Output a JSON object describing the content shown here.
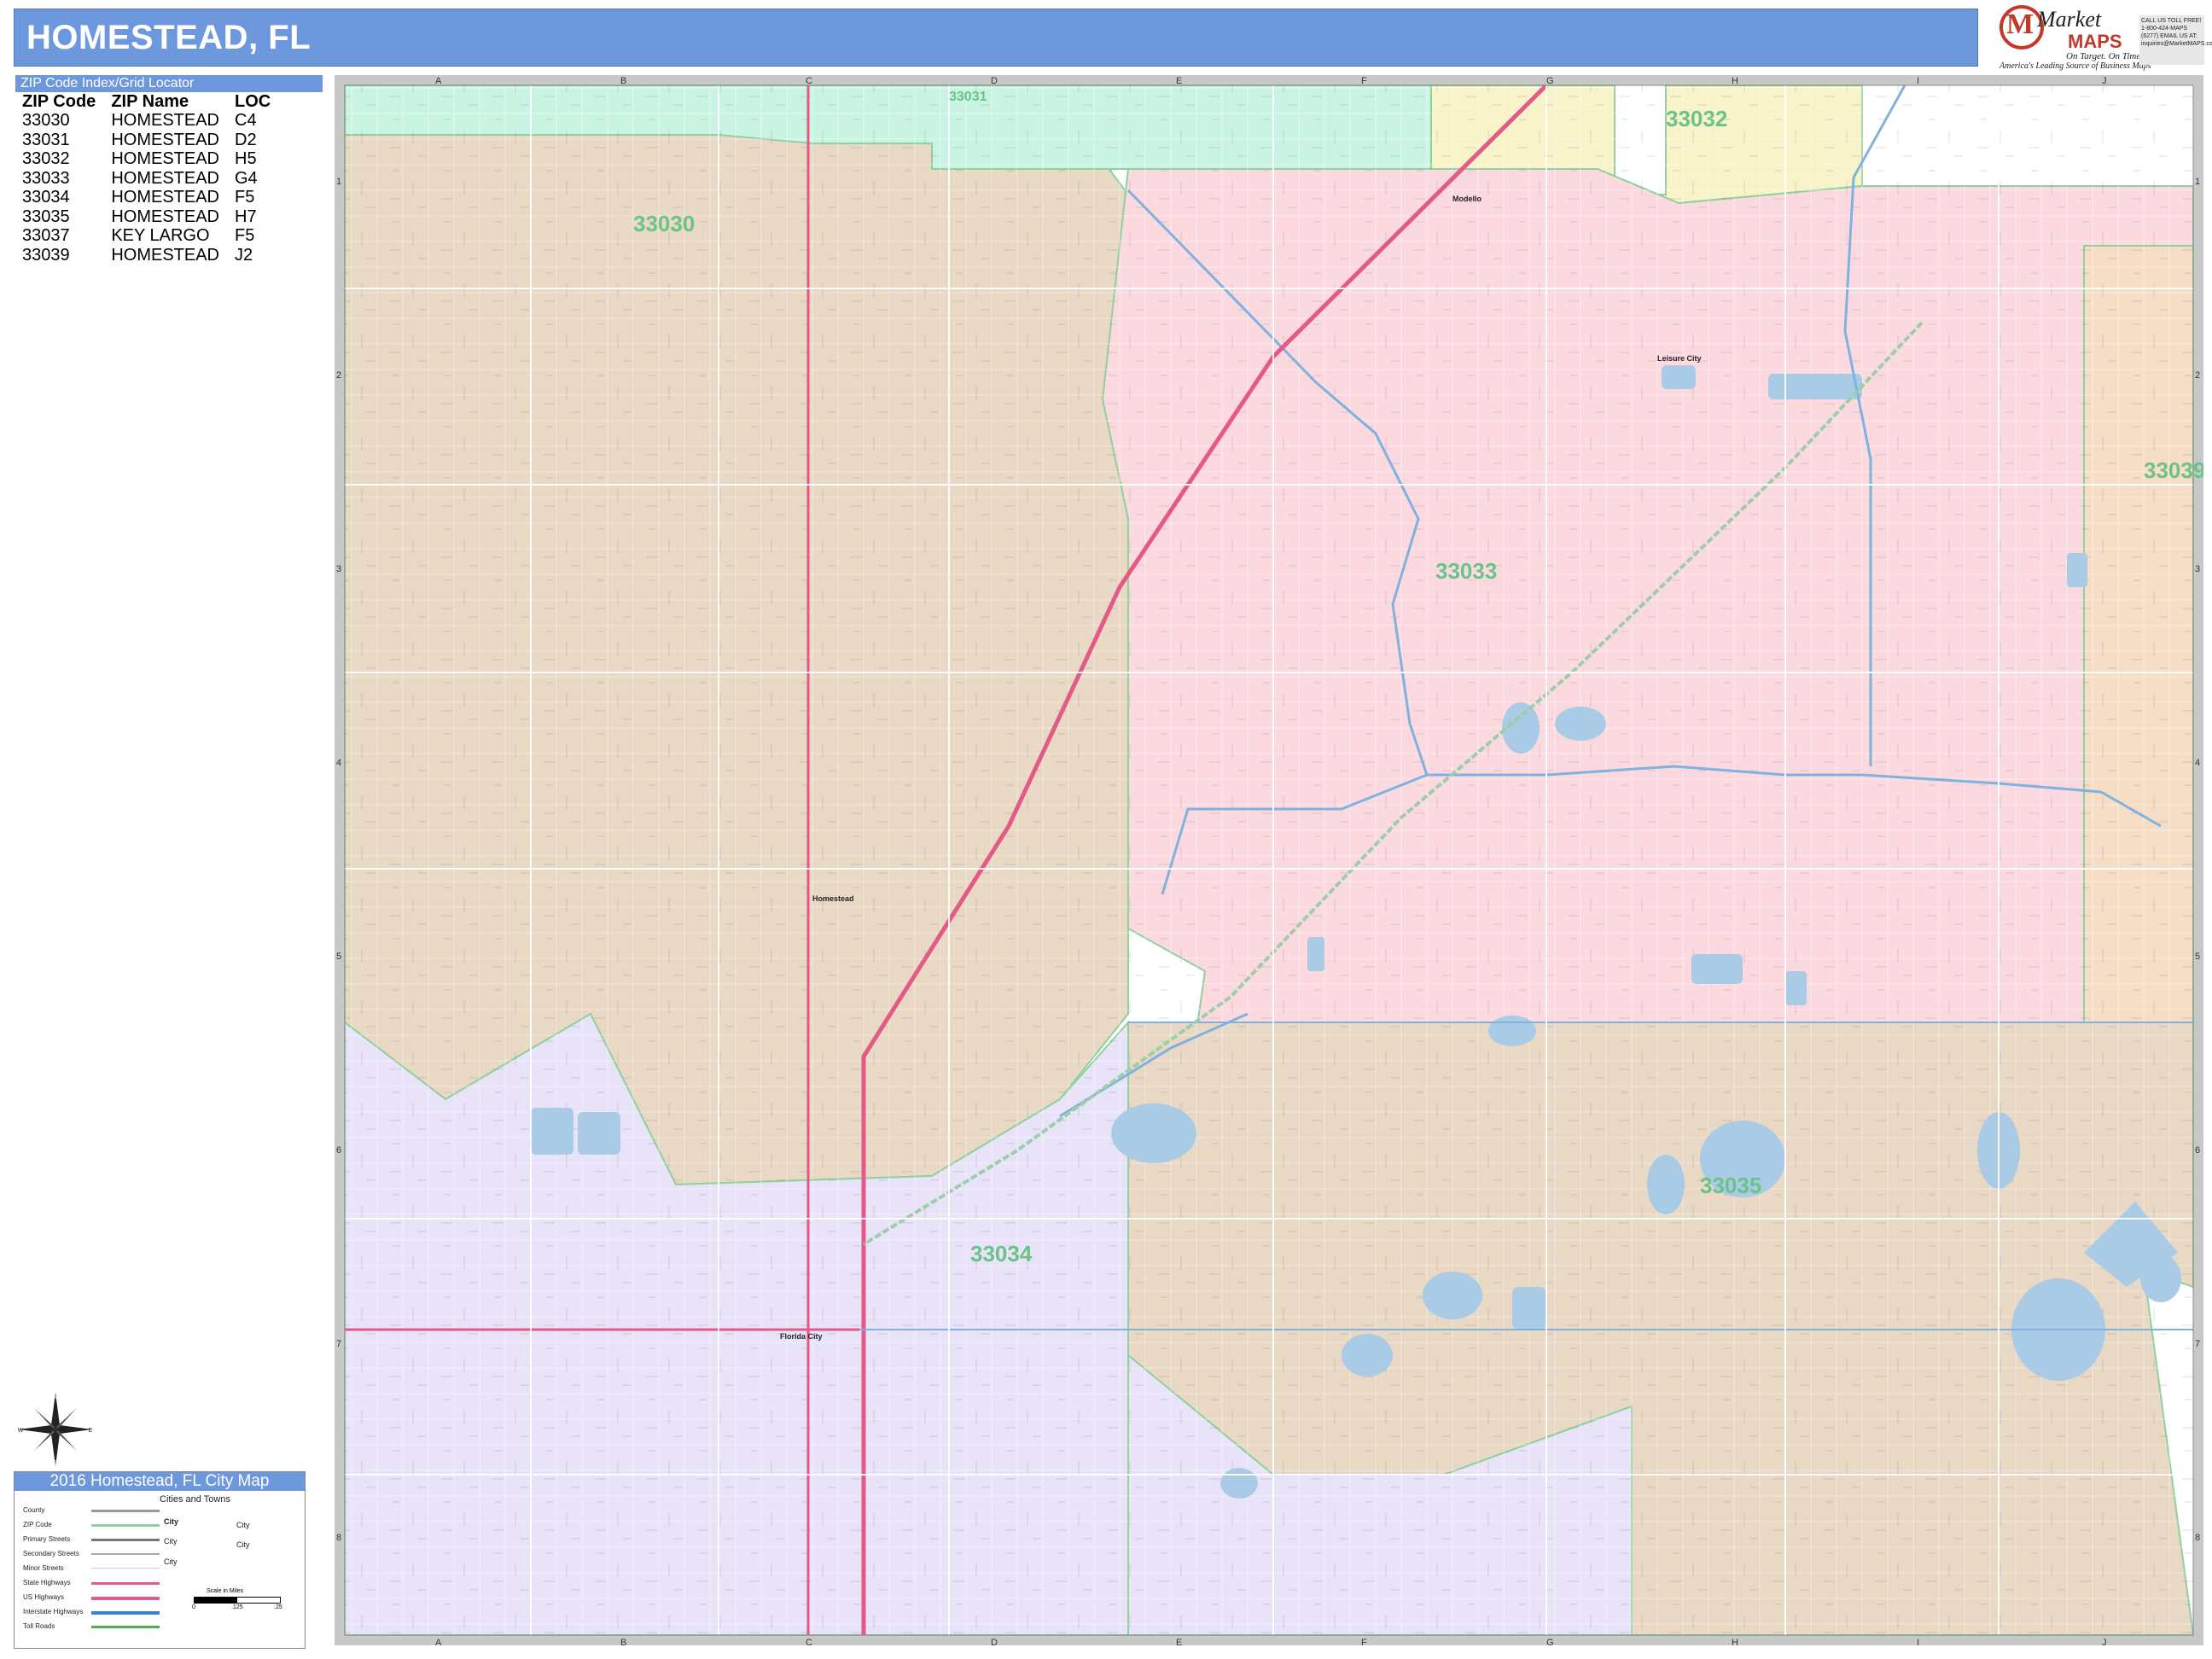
{
  "header": {
    "title": "HOMESTEAD, FL"
  },
  "logo": {
    "market": "Market",
    "maps": "MAPS",
    "tagline": "On Target. On Time.",
    "subtagline": "America's Leading Source of Business Maps",
    "contact": "CALL US TOLL FREE! 1-800-424-MAPS (6277) EMAIL US AT: inquiries@MarketMAPS.com"
  },
  "zip_index": {
    "heading": "ZIP Code Index/Grid Locator",
    "columns": [
      "ZIP Code",
      "ZIP Name",
      "LOC"
    ],
    "rows": [
      [
        "33030",
        "HOMESTEAD",
        "C4"
      ],
      [
        "33031",
        "HOMESTEAD",
        "D2"
      ],
      [
        "33032",
        "HOMESTEAD",
        "H5"
      ],
      [
        "33033",
        "HOMESTEAD",
        "G4"
      ],
      [
        "33034",
        "HOMESTEAD",
        "F5"
      ],
      [
        "33035",
        "HOMESTEAD",
        "H7"
      ],
      [
        "33037",
        "KEY LARGO",
        "F5"
      ],
      [
        "33039",
        "HOMESTEAD",
        "J2"
      ]
    ]
  },
  "compass": {
    "n": "N",
    "s": "S",
    "e": "E",
    "w": "W"
  },
  "legend": {
    "title": "2016 Homestead, FL City Map",
    "items": [
      "County",
      "ZIP Code",
      "Primary Streets",
      "Secondary Streets",
      "Minor Streets",
      "State Highways",
      "US Highways",
      "Interstate Highways",
      "Toll Roads"
    ],
    "cities_heading": "Cities and Towns",
    "city_label": "City",
    "scale_label": "Scale in Miles",
    "scale_ticks": [
      "0",
      ".125",
      ".25"
    ]
  },
  "map": {
    "columns": [
      "A",
      "B",
      "C",
      "D",
      "E",
      "F",
      "G",
      "H",
      "I",
      "J"
    ],
    "rows": [
      "1",
      "2",
      "3",
      "4",
      "5",
      "6",
      "7",
      "8"
    ],
    "zips": [
      {
        "code": "33030",
        "color": "#e8d8c4"
      },
      {
        "code": "33031",
        "color": "#c9f4e3"
      },
      {
        "code": "33032",
        "color": "#f8f3c8"
      },
      {
        "code": "33033",
        "color": "#fbd9df"
      },
      {
        "code": "33034",
        "color": "#e8e3f8"
      },
      {
        "code": "33035",
        "color": "#e8d8c4"
      },
      {
        "code": "33039",
        "color": "#f6ddc6"
      }
    ],
    "places": [
      "Modello",
      "Leisure City",
      "Homestead",
      "Florida City"
    ],
    "water_color": "#a9cbe6",
    "road_color": "#e35a87"
  }
}
